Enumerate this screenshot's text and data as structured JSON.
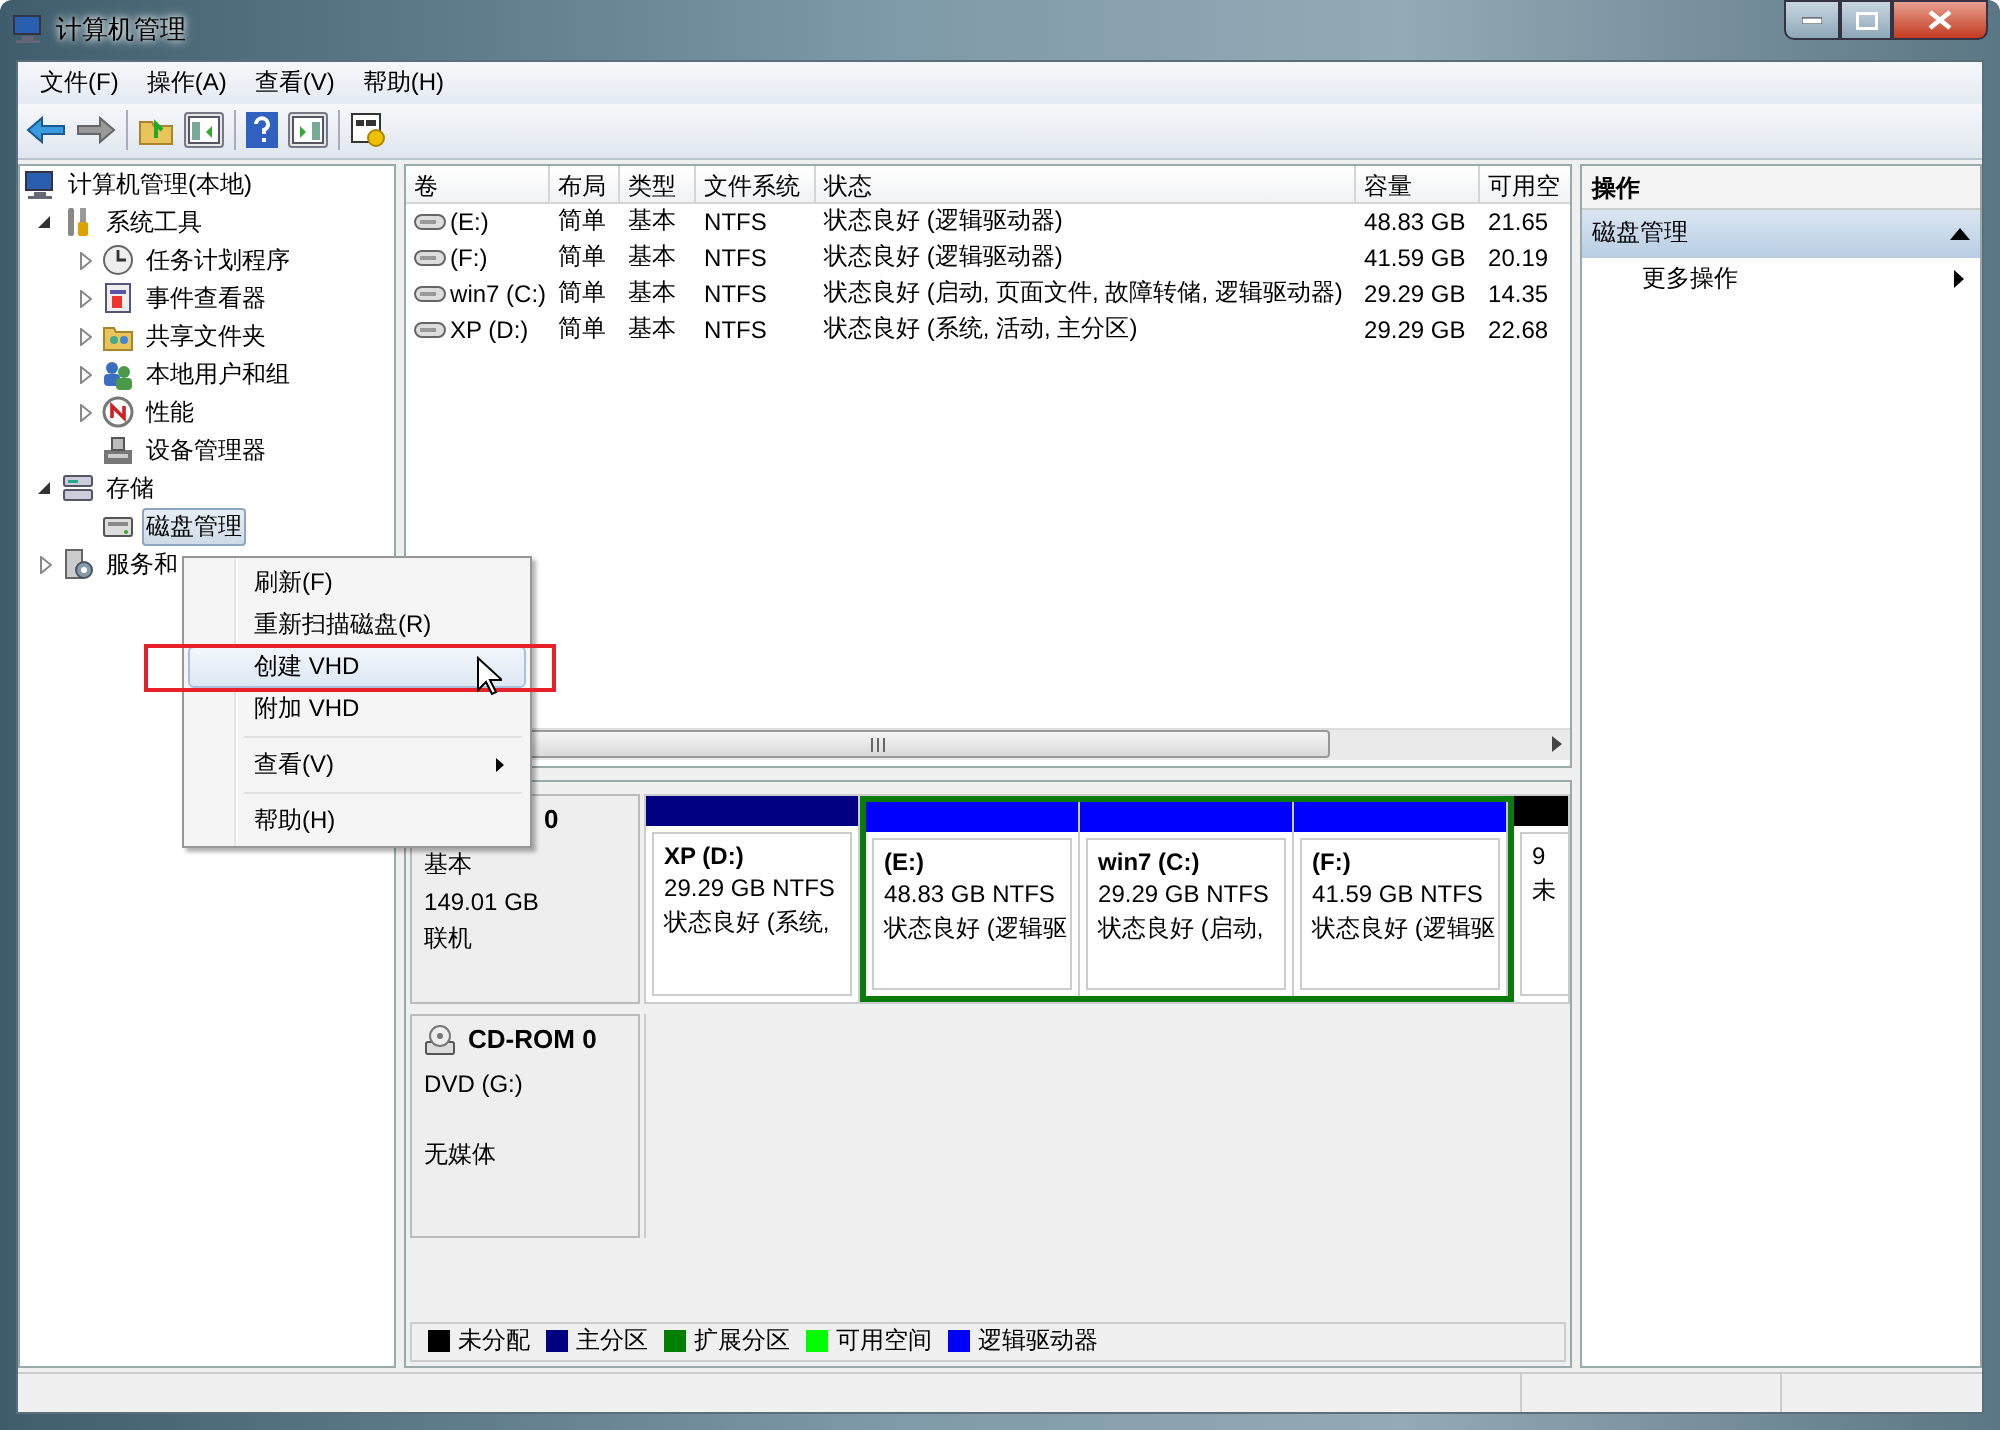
{
  "window": {
    "title": "计算机管理"
  },
  "menu": [
    "文件(F)",
    "操作(A)",
    "查看(V)",
    "帮助(H)"
  ],
  "tree": [
    {
      "label": "计算机管理(本地)",
      "selected": false,
      "children": [
        {
          "label": "系统工具",
          "expanded": true,
          "selected": false,
          "children": [
            {
              "label": "任务计划程序",
              "expanded": false,
              "selected": false
            },
            {
              "label": "事件查看器",
              "expanded": false,
              "selected": false
            },
            {
              "label": "共享文件夹",
              "expanded": false,
              "selected": false
            },
            {
              "label": "本地用户和组",
              "expanded": false,
              "selected": false
            },
            {
              "label": "性能",
              "expanded": false,
              "selected": false
            },
            {
              "label": "设备管理器",
              "selected": false
            }
          ]
        },
        {
          "label": "存储",
          "expanded": true,
          "selected": false,
          "children": [
            {
              "label": "磁盘管理",
              "selected": true
            }
          ]
        },
        {
          "label": "服务和",
          "expanded": false,
          "selected": false
        }
      ]
    }
  ],
  "table": {
    "columns": [
      "卷",
      "布局",
      "类型",
      "文件系统",
      "状态",
      "容量",
      "可用空"
    ],
    "rows": [
      {
        "cells": [
          "(E:)",
          "简单",
          "基本",
          "NTFS",
          "状态良好 (逻辑驱动器)",
          "48.83 GB",
          "21.65"
        ]
      },
      {
        "cells": [
          "(F:)",
          "简单",
          "基本",
          "NTFS",
          "状态良好 (逻辑驱动器)",
          "41.59 GB",
          "20.19"
        ]
      },
      {
        "cells": [
          "win7 (C:)",
          "简单",
          "基本",
          "NTFS",
          "状态良好 (启动, 页面文件, 故障转储, 逻辑驱动器)",
          "29.29 GB",
          "14.35"
        ]
      },
      {
        "cells": [
          "XP (D:)",
          "简单",
          "基本",
          "NTFS",
          "状态良好 (系统, 活动, 主分区)",
          "29.29 GB",
          "22.68"
        ]
      }
    ]
  },
  "disks": [
    {
      "name": "0",
      "type": "基本",
      "size": "149.01 GB",
      "status": "联机",
      "partitions": [
        {
          "label": "XP  (D:)",
          "size": "29.29 GB NTFS",
          "status": "状态良好 (系统,",
          "color": "#000080",
          "extended": false
        },
        {
          "label": "(E:)",
          "size": "48.83 GB NTFS",
          "status": "状态良好 (逻辑驱",
          "color": "#0000ff",
          "extended": true
        },
        {
          "label": "win7  (C:)",
          "size": "29.29 GB NTFS",
          "status": "状态良好 (启动,",
          "color": "#0000ff",
          "extended": true
        },
        {
          "label": "(F:)",
          "size": "41.59 GB NTFS",
          "status": "状态良好 (逻辑驱",
          "color": "#0000ff",
          "extended": true
        },
        {
          "size": "9",
          "status": "未",
          "color": "#000000",
          "extended": false
        }
      ]
    },
    {
      "name": "CD-ROM 0",
      "type": "DVD (G:)",
      "status": "无媒体"
    }
  ],
  "legend": [
    {
      "label": "未分配",
      "color": "#000000"
    },
    {
      "label": "主分区",
      "color": "#000080"
    },
    {
      "label": "扩展分区",
      "color": "#008000"
    },
    {
      "label": "可用空间",
      "color": "#00ff00"
    },
    {
      "label": "逻辑驱动器",
      "color": "#0000ff"
    }
  ],
  "actions": {
    "header": "操作",
    "sections": [
      {
        "title": "磁盘管理",
        "expanded": true,
        "items": [
          {
            "label": "更多操作",
            "kind": "submenu"
          }
        ]
      }
    ]
  },
  "context_menu": [
    {
      "kind": "item",
      "label": "刷新(F)",
      "selected": false
    },
    {
      "kind": "item",
      "label": "重新扫描磁盘(R)",
      "selected": false
    },
    {
      "kind": "item",
      "label": "创建 VHD",
      "selected": true
    },
    {
      "kind": "item",
      "label": "附加 VHD",
      "selected": false
    },
    {
      "kind": "separator"
    },
    {
      "kind": "submenu",
      "label": "查看(V)",
      "selected": false
    },
    {
      "kind": "separator"
    },
    {
      "kind": "item",
      "label": "帮助(H)",
      "selected": false
    }
  ]
}
